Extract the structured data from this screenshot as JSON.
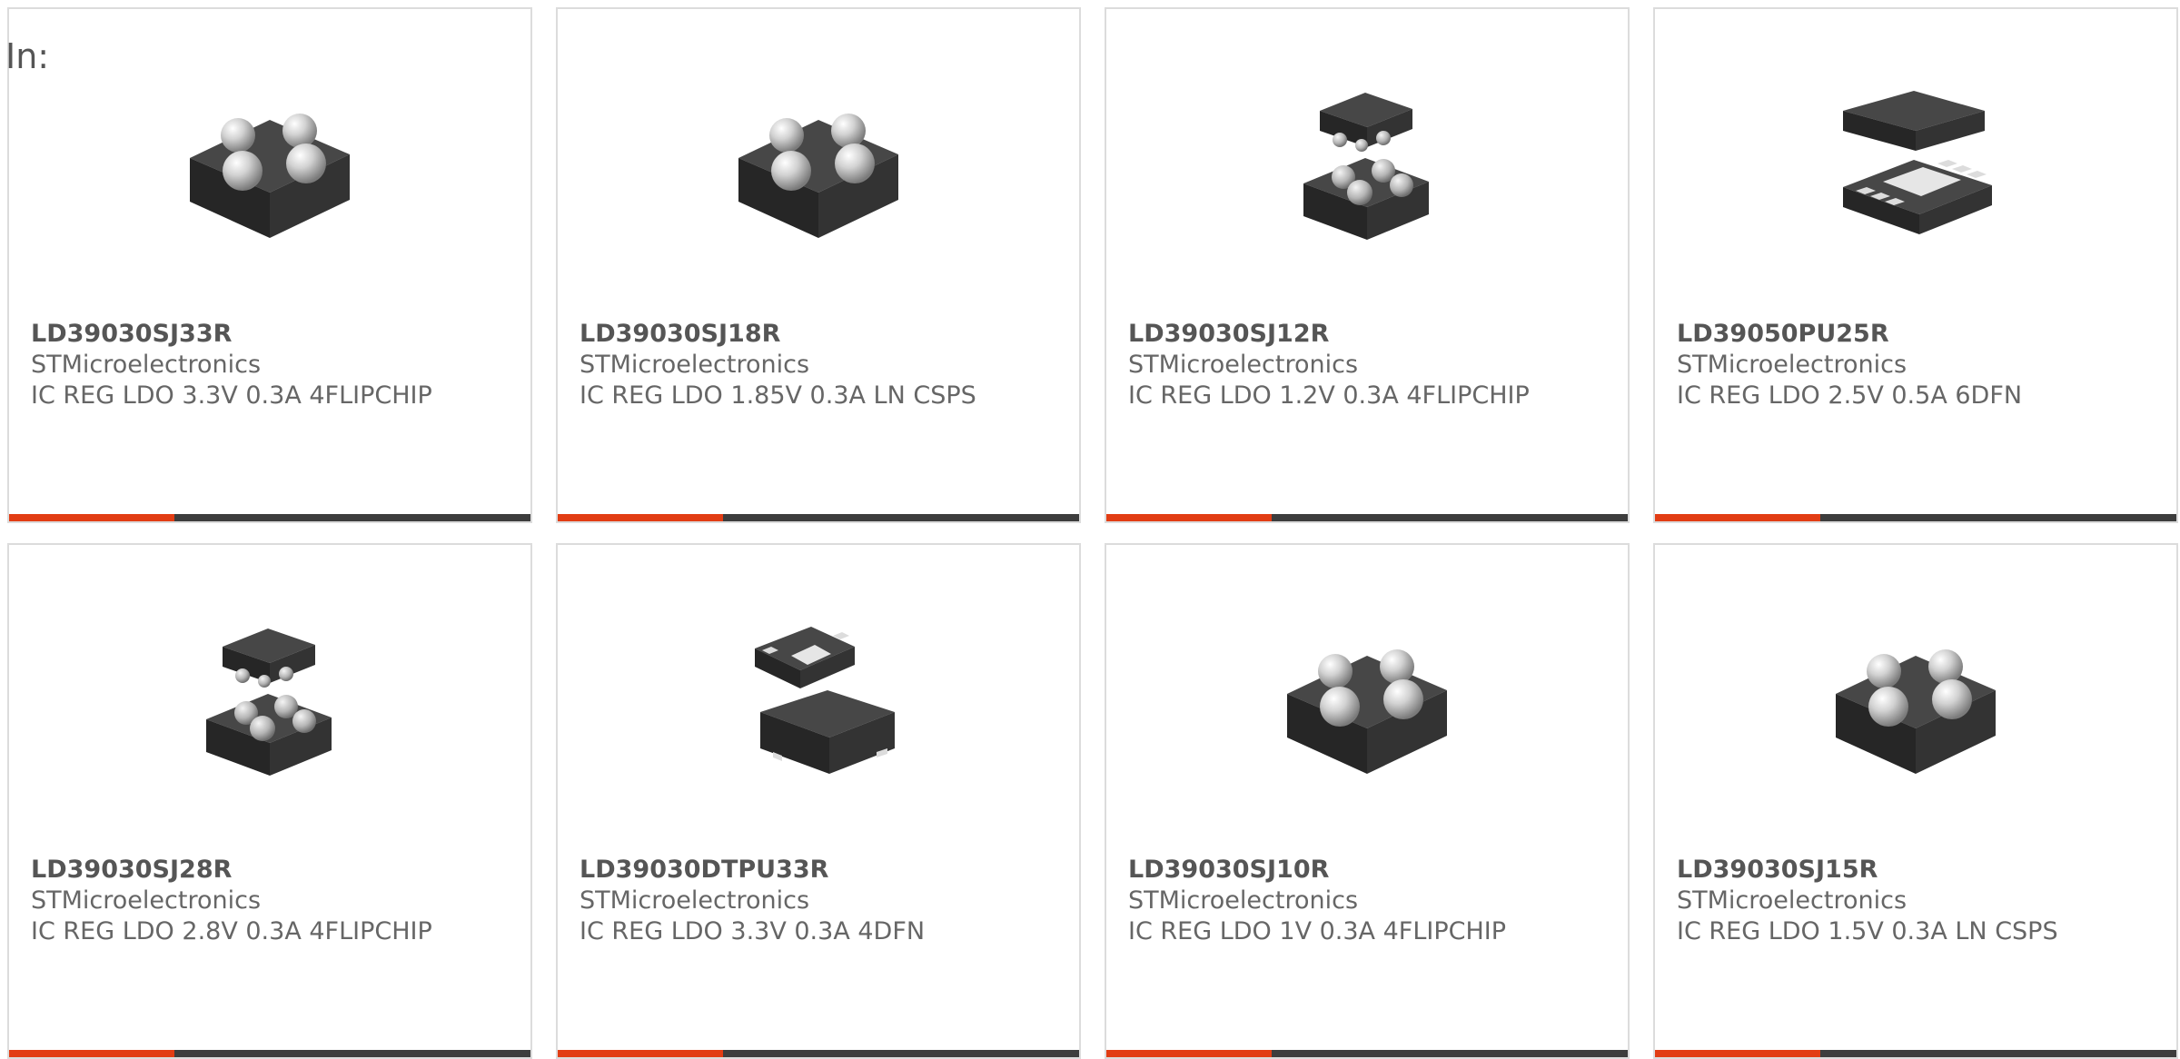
{
  "heading": "In:",
  "colors": {
    "accent": "#e23d14",
    "bar": "#3d3d3d",
    "card_border": "#dcdcdc",
    "text": "#666666"
  },
  "products": [
    {
      "part": "LD39030SJ33R",
      "manufacturer": "STMicroelectronics",
      "description": "IC REG LDO 3.3V 0.3A 4FLIPCHIP",
      "image_icon": "flipchip-4-ball-icon"
    },
    {
      "part": "LD39030SJ18R",
      "manufacturer": "STMicroelectronics",
      "description": "IC REG LDO 1.85V 0.3A LN CSPS",
      "image_icon": "flipchip-4-ball-icon"
    },
    {
      "part": "LD39030SJ12R",
      "manufacturer": "STMicroelectronics",
      "description": "IC REG LDO 1.2V 0.3A 4FLIPCHIP",
      "image_icon": "flipchip-two-view-icon"
    },
    {
      "part": "LD39050PU25R",
      "manufacturer": "STMicroelectronics",
      "description": "IC REG LDO 2.5V 0.5A 6DFN",
      "image_icon": "dfn-6-package-icon"
    },
    {
      "part": "LD39030SJ28R",
      "manufacturer": "STMicroelectronics",
      "description": "IC REG LDO 2.8V 0.3A 4FLIPCHIP",
      "image_icon": "flipchip-two-view-icon"
    },
    {
      "part": "LD39030DTPU33R",
      "manufacturer": "STMicroelectronics",
      "description": "IC REG LDO 3.3V 0.3A 4DFN",
      "image_icon": "dfn-4-package-icon"
    },
    {
      "part": "LD39030SJ10R",
      "manufacturer": "STMicroelectronics",
      "description": "IC REG LDO 1V 0.3A 4FLIPCHIP",
      "image_icon": "flipchip-4-ball-icon"
    },
    {
      "part": "LD39030SJ15R",
      "manufacturer": "STMicroelectronics",
      "description": "IC REG LDO 1.5V 0.3A LN CSPS",
      "image_icon": "flipchip-4-ball-icon"
    }
  ]
}
